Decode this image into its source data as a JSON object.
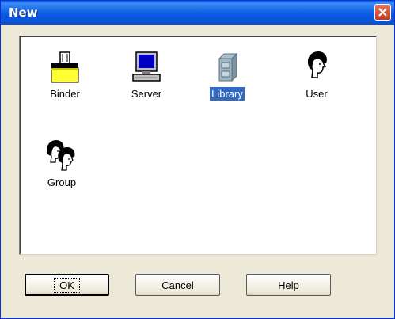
{
  "window": {
    "title": "New"
  },
  "icons": [
    {
      "label": "Binder",
      "icon": "binder-icon",
      "selected": false
    },
    {
      "label": "Server",
      "icon": "server-computer-icon",
      "selected": false
    },
    {
      "label": "Library",
      "icon": "library-cabinet-icon",
      "selected": true
    },
    {
      "label": "User",
      "icon": "user-head-icon",
      "selected": false
    },
    {
      "label": "Group",
      "icon": "group-heads-icon",
      "selected": false
    }
  ],
  "buttons": {
    "ok": "OK",
    "cancel": "Cancel",
    "help": "Help"
  },
  "colors": {
    "titlebar": "#0a5fe6",
    "selection": "#316ac5",
    "dialog_bg": "#ece9d8"
  }
}
